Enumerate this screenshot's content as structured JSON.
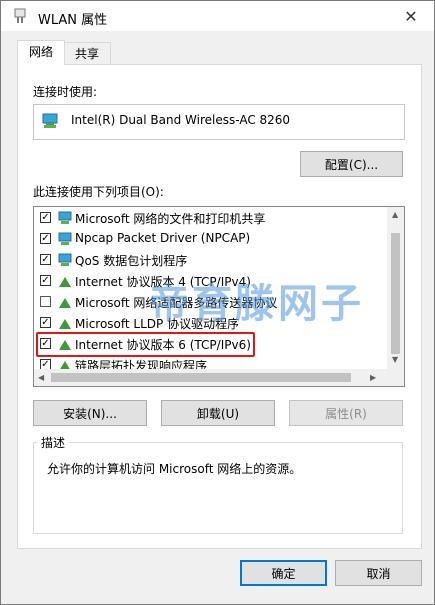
{
  "window": {
    "title": "WLAN 属性",
    "close_glyph": "✕"
  },
  "tabs": [
    {
      "label": "网络",
      "active": true
    },
    {
      "label": "共享",
      "active": false
    }
  ],
  "connect_using": {
    "label": "连接时使用:",
    "adapter": "Intel(R) Dual Band Wireless-AC 8260",
    "configure_button": "配置(C)..."
  },
  "items": {
    "label": "此连接使用下列项目(O):",
    "list": [
      {
        "label": "Microsoft 网络的文件和打印机共享",
        "checked": true,
        "icon": "network-client-icon"
      },
      {
        "label": "Npcap Packet Driver (NPCAP)",
        "checked": true,
        "icon": "network-service-icon"
      },
      {
        "label": "QoS 数据包计划程序",
        "checked": true,
        "icon": "network-service-icon"
      },
      {
        "label": "Internet 协议版本 4 (TCP/IPv4)",
        "checked": true,
        "icon": "protocol-icon"
      },
      {
        "label": "Microsoft 网络适配器多路传送器协议",
        "checked": false,
        "icon": "protocol-icon"
      },
      {
        "label": "Microsoft LLDP 协议驱动程序",
        "checked": true,
        "icon": "protocol-icon"
      },
      {
        "label": "Internet 协议版本 6 (TCP/IPv6)",
        "checked": true,
        "icon": "protocol-icon"
      },
      {
        "label": "链路层拓扑发现响应程序",
        "checked": true,
        "icon": "protocol-icon"
      }
    ]
  },
  "actions": {
    "install": "安装(N)...",
    "uninstall": "卸载(U)",
    "properties": "属性(R)"
  },
  "description": {
    "title": "描述",
    "text": "允许你的计算机访问 Microsoft 网络上的资源。"
  },
  "watermark": "帝育滕网子",
  "footer": {
    "ok": "确定",
    "cancel": "取消"
  },
  "colors": {
    "highlight_border": "#e0161b",
    "default_button_border": "#0078d7"
  }
}
